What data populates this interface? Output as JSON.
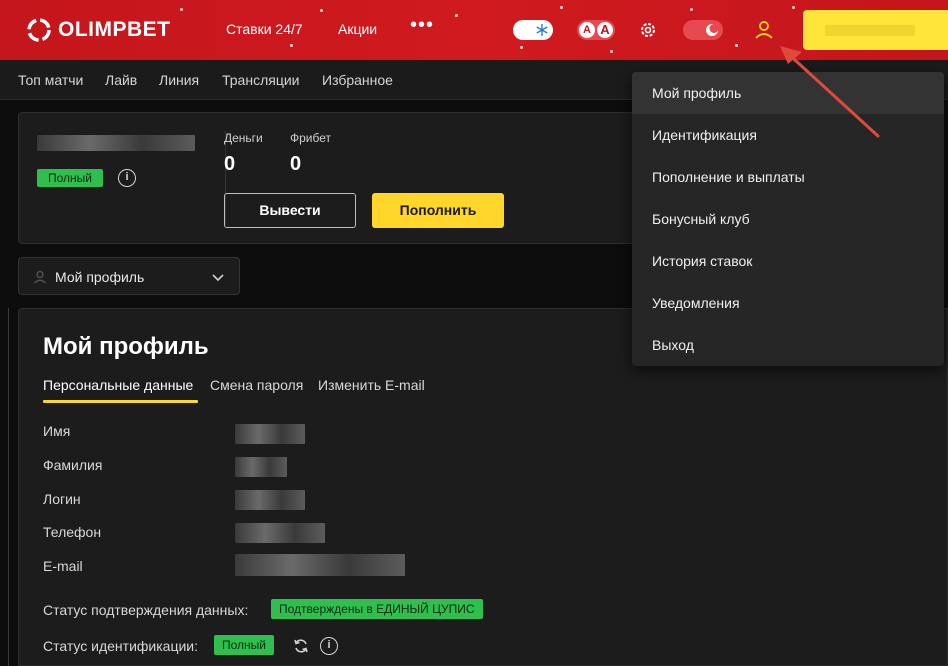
{
  "header": {
    "brand": "OLIMPBET",
    "nav": [
      "Ставки 24/7",
      "Акции"
    ],
    "more": "•••",
    "font_toggle": [
      "A",
      "A"
    ],
    "icons": [
      "snowflake-icon",
      "gear-icon",
      "theme-toggle-icon",
      "user-icon"
    ],
    "colors": {
      "header_bg": "#c4161c",
      "accent": "#ffd629"
    }
  },
  "subnav": [
    "Топ матчи",
    "Лайв",
    "Линия",
    "Трансляции",
    "Избранное"
  ],
  "account": {
    "status_badge": "Полный",
    "balances": [
      {
        "label": "Деньги",
        "value": "0"
      },
      {
        "label": "Фрибет",
        "value": "0"
      }
    ],
    "withdraw_label": "Вывести",
    "deposit_label": "Пополнить"
  },
  "selector": {
    "label": "Мой профиль"
  },
  "profile": {
    "title": "Мой профиль",
    "tabs": [
      "Персональные данные",
      "Смена пароля",
      "Изменить E-mail"
    ],
    "fields": [
      "Имя",
      "Фамилия",
      "Логин",
      "Телефон",
      "E-mail"
    ],
    "data_status_label": "Статус подтверждения данных:",
    "data_status_value": "Подтверждены в ЕДИНЫЙ ЦУПИС",
    "ident_status_label": "Статус идентификации:",
    "ident_status_value": "Полный"
  },
  "menu": {
    "items": [
      "Мой профиль",
      "Идентификация",
      "Пополнение и выплаты",
      "Бонусный клуб",
      "История ставок",
      "Уведомления",
      "Выход"
    ]
  }
}
